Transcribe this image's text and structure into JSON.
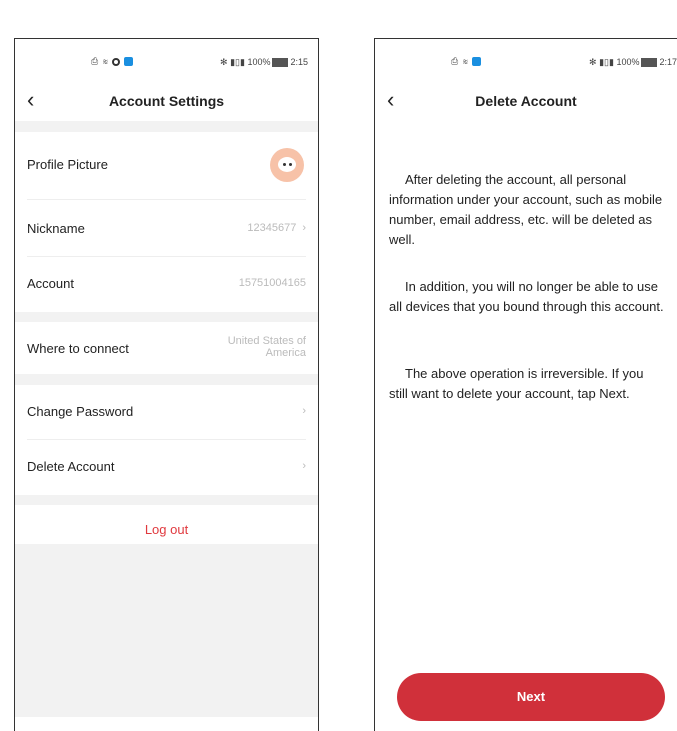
{
  "left": {
    "status": {
      "icons_left": "⎙ ≋",
      "right_text": "✻ ▮▯▮ 100%",
      "time": "2:15"
    },
    "title": "Account Settings",
    "profile_label": "Profile Picture",
    "nickname_label": "Nickname",
    "nickname_value": "12345677",
    "account_label": "Account",
    "account_value": "15751004165",
    "connect_label": "Where to connect",
    "connect_value": "United States of America",
    "change_password_label": "Change Password",
    "delete_account_label": "Delete Account",
    "logout_label": "Log out"
  },
  "right": {
    "status": {
      "icons_left": "⎙ ≋",
      "right_text": "✻ ▮▯▮ 100%",
      "time": "2:17"
    },
    "title": "Delete Account",
    "para1": "After deleting the account, all personal information under your account, such as mobile number, email address, etc. will be deleted as well.",
    "para2": "In addition, you will no longer be able to use all devices that you bound through this account.",
    "para3": "The above operation is irreversible. If you still want to delete your account, tap Next.",
    "next_label": "Next"
  },
  "colors": {
    "accent_red": "#d0303a",
    "logout_red": "#e0393e",
    "section_gray": "#f2f2f2"
  },
  "icons": {
    "back": "chevron-left-icon",
    "chevron": "chevron-right-icon"
  }
}
